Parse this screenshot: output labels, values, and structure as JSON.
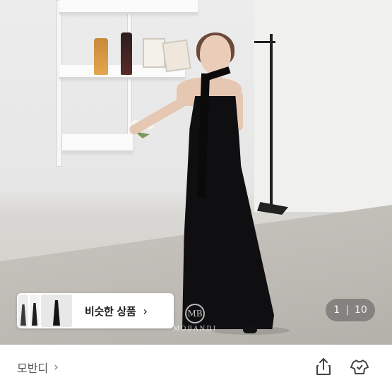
{
  "gallery": {
    "current_page": "1",
    "separator": "|",
    "total_pages": "10",
    "watermark_text": "MOBANDI",
    "watermark_seal": "MB"
  },
  "similar": {
    "label": "비슷한 상품",
    "chevron": "›"
  },
  "store": {
    "name": "모반디",
    "chevron": "›"
  },
  "icons": {
    "share": "share-icon",
    "wishlist": "hanger-icon"
  }
}
